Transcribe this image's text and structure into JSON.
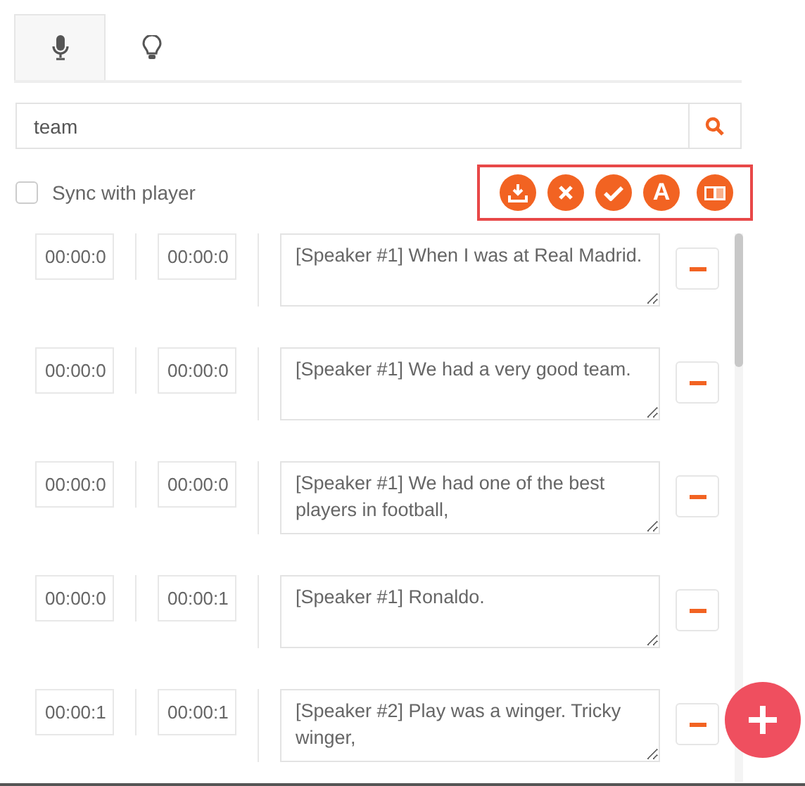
{
  "tabs": [
    {
      "kind": "microphone",
      "selected": true
    },
    {
      "kind": "lightbulb",
      "selected": false
    }
  ],
  "search": {
    "value": "team"
  },
  "sync": {
    "label": "Sync with player",
    "checked": false
  },
  "toolbar": [
    {
      "kind": "download"
    },
    {
      "kind": "close"
    },
    {
      "kind": "check"
    },
    {
      "kind": "font",
      "glyph": "A"
    },
    {
      "kind": "translate"
    }
  ],
  "segments": [
    {
      "start": "00:00:0",
      "end": "00:00:0",
      "text": "[Speaker #1] When I was at Real Madrid."
    },
    {
      "start": "00:00:0",
      "end": "00:00:0",
      "text": "[Speaker #1] We had a very good team."
    },
    {
      "start": "00:00:0",
      "end": "00:00:0",
      "text": "[Speaker #1] We had one of the best players in football,"
    },
    {
      "start": "00:00:0",
      "end": "00:00:1",
      "text": "[Speaker #1] Ronaldo."
    },
    {
      "start": "00:00:1",
      "end": "00:00:1",
      "text": "[Speaker #2] Play was a winger. Tricky winger,"
    }
  ]
}
